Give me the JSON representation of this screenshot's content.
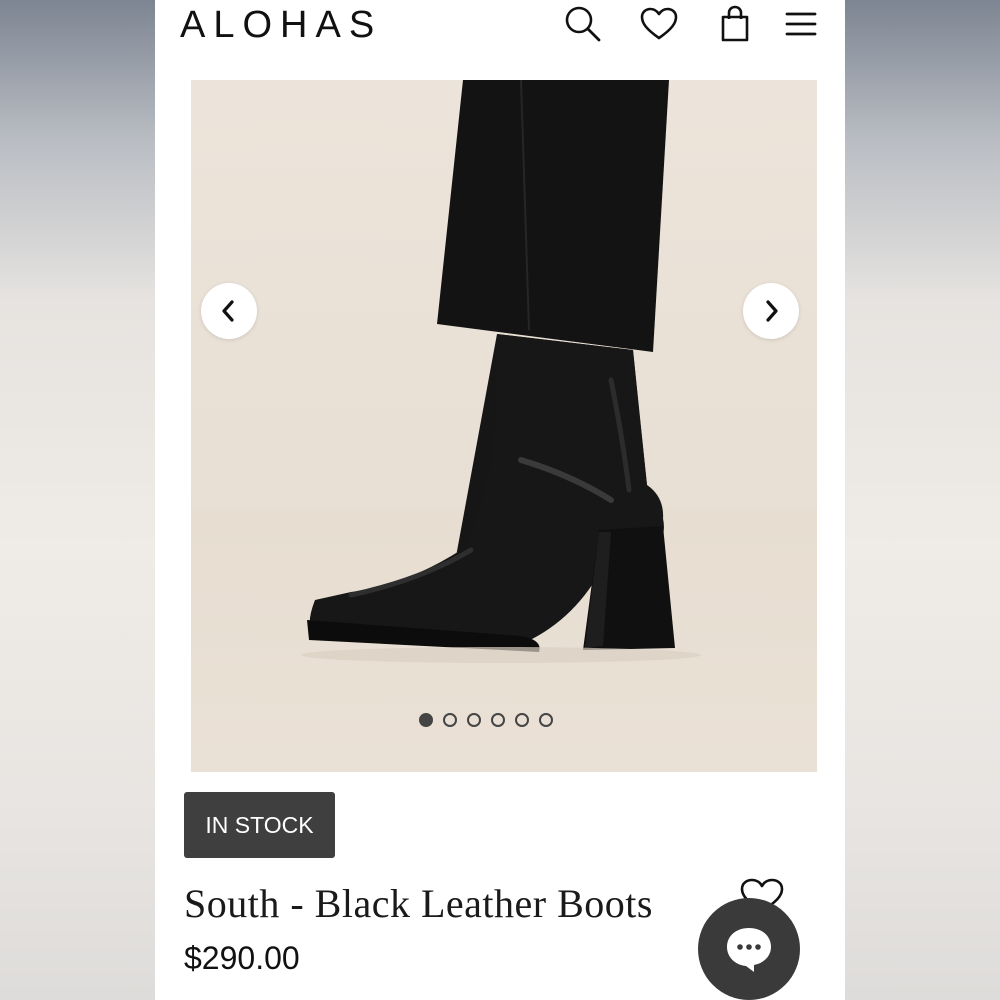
{
  "header": {
    "brand": "ALOHAS",
    "icons": [
      "search-icon",
      "heart-icon",
      "bag-icon",
      "menu-icon"
    ]
  },
  "gallery": {
    "prev_icon": "chevron-left-icon",
    "next_icon": "chevron-right-icon",
    "image": "black-leather-boot-photo",
    "slide_count": 6,
    "active_slide": 1
  },
  "product": {
    "stock_badge": "IN STOCK",
    "title": "South - Black Leather Boots",
    "price": "$290.00",
    "wishlist_icon": "heart-outline-icon"
  },
  "chat": {
    "icon": "chat-bubble-icon"
  },
  "colors": {
    "badge_bg": "#3f3f3f",
    "chat_bg": "#3a3a3a",
    "gallery_bg": "#e9e0d5"
  }
}
